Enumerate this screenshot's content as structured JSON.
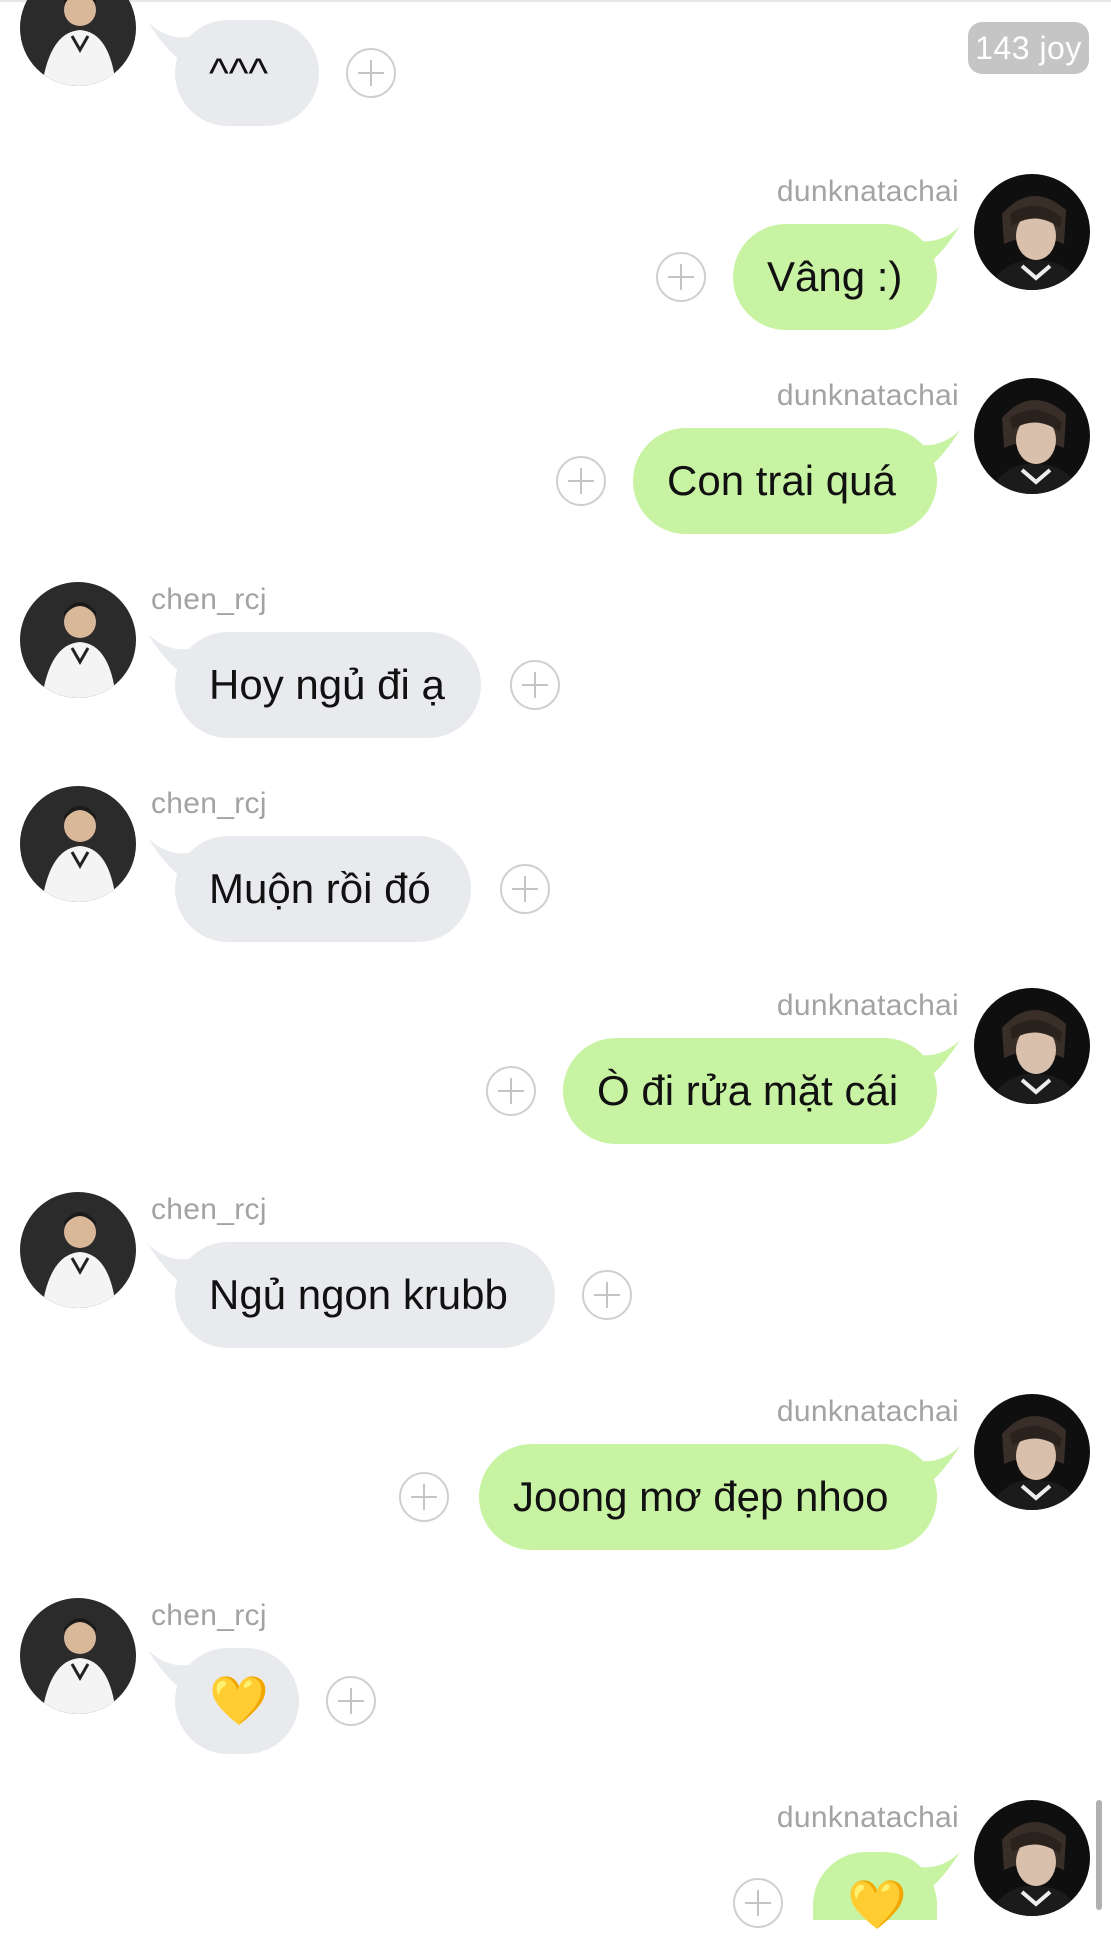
{
  "watermark": "143 joy",
  "users": {
    "left": "chen_rcj",
    "right": "dunknatachai"
  },
  "messages": [
    {
      "side": "in",
      "name": "",
      "text": "^^^"
    },
    {
      "side": "out",
      "name": "dunknatachai",
      "text": "Vâng :)"
    },
    {
      "side": "out",
      "name": "dunknatachai",
      "text": "Con trai quá"
    },
    {
      "side": "in",
      "name": "chen_rcj",
      "text": "Hoy ngủ đi ạ"
    },
    {
      "side": "in",
      "name": "chen_rcj",
      "text": "Muộn rồi đó"
    },
    {
      "side": "out",
      "name": "dunknatachai",
      "text": "Ò đi rửa mặt cái"
    },
    {
      "side": "in",
      "name": "chen_rcj",
      "text": "Ngủ ngon krubb"
    },
    {
      "side": "out",
      "name": "dunknatachai",
      "text": "Joong mơ đẹp nhoo"
    },
    {
      "side": "in",
      "name": "chen_rcj",
      "text": "💛"
    },
    {
      "side": "out",
      "name": "dunknatachai",
      "text": "💛"
    }
  ],
  "icons": {
    "add_reaction": "plus-circle-icon",
    "heart": "yellow-heart-icon"
  },
  "colors": {
    "incoming_bubble": "#e8eaed",
    "outgoing_bubble": "#c8f3a3",
    "username": "#a3a3a3"
  }
}
